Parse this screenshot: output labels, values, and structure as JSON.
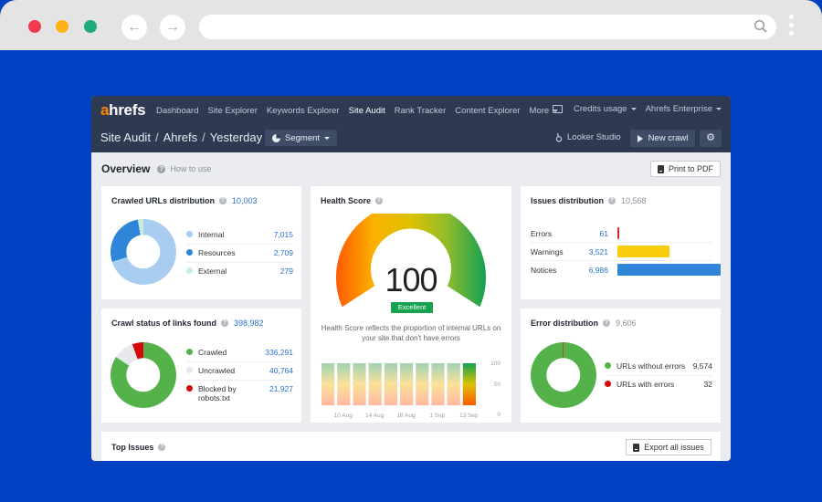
{
  "browser": {
    "back_icon": "arrow-left-icon",
    "forward_icon": "arrow-right-icon",
    "url": "",
    "search_icon": "search-icon",
    "menu_icon": "kebab-menu-icon",
    "window_dots": [
      "#ef3a50",
      "#fdb314",
      "#1faa7e"
    ]
  },
  "nav": {
    "logo_a": "a",
    "logo_rest": "hrefs",
    "items": [
      {
        "label": "Dashboard",
        "active": false
      },
      {
        "label": "Site Explorer",
        "active": false
      },
      {
        "label": "Keywords Explorer",
        "active": false
      },
      {
        "label": "Site Audit",
        "active": true
      },
      {
        "label": "Rank Tracker",
        "active": false
      },
      {
        "label": "Content Explorer",
        "active": false
      },
      {
        "label": "More",
        "active": false,
        "dropdown": true
      }
    ],
    "credits": "Credits usage",
    "account": "Ahrefs Enterprise"
  },
  "subnav": {
    "breadcrumb": [
      "Site Audit",
      "Ahrefs",
      "Yesterday"
    ],
    "segment": "Segment",
    "looker": "Looker Studio",
    "new_crawl": "New crawl",
    "settings_icon": "gear-icon"
  },
  "overview": {
    "title": "Overview",
    "how_to_use": "How to use",
    "print": "Print to PDF"
  },
  "crawled_urls": {
    "title": "Crawled URLs distribution",
    "total": "10,003",
    "items": [
      {
        "label": "Internal",
        "value": "7,015",
        "count": 7015,
        "color": "#a8cdf1"
      },
      {
        "label": "Resources",
        "value": "2,709",
        "count": 2709,
        "color": "#2f86d9"
      },
      {
        "label": "External",
        "value": "279",
        "count": 279,
        "color": "#c8ecdc"
      }
    ]
  },
  "crawl_status": {
    "title": "Crawl status of links found",
    "total": "398,982",
    "items": [
      {
        "label": "Crawled",
        "value": "336,291",
        "count": 336291,
        "color": "#55b24b"
      },
      {
        "label": "Uncrawled",
        "value": "40,764",
        "count": 40764,
        "color": "#e6e8eb"
      },
      {
        "label": "Blocked by robots.txt",
        "value": "21,927",
        "count": 21927,
        "color": "#d40a0a"
      }
    ]
  },
  "health": {
    "title": "Health Score",
    "score": "100",
    "badge": "Excellent",
    "description": "Health Score reflects the proportion of internal URLs on your site that don't have errors",
    "history": [
      100,
      100,
      100,
      100,
      100,
      100,
      100,
      100,
      100,
      100
    ],
    "x_labels": [
      "10 Aug",
      "14 Aug",
      "18 Aug",
      "1 Sep",
      "13 Sep"
    ],
    "y_labels": [
      "100",
      "50",
      "0"
    ]
  },
  "issues": {
    "title": "Issues distribution",
    "total": "10,568",
    "items": [
      {
        "label": "Errors",
        "value": "61",
        "count": 61,
        "color": "#d42a2a"
      },
      {
        "label": "Warnings",
        "value": "3,521",
        "count": 3521,
        "color": "#f9cd0b"
      },
      {
        "label": "Notices",
        "value": "6,986",
        "count": 6986,
        "color": "#2f86d9"
      }
    ]
  },
  "errors": {
    "title": "Error distribution",
    "total": "9,606",
    "items": [
      {
        "label": "URLs without errors",
        "value": "9,574",
        "count": 9574,
        "color": "#55b24b"
      },
      {
        "label": "URLs with errors",
        "value": "32",
        "count": 32,
        "color": "#d40a0a"
      }
    ]
  },
  "top_issues": {
    "title": "Top Issues",
    "export": "Export all issues"
  }
}
